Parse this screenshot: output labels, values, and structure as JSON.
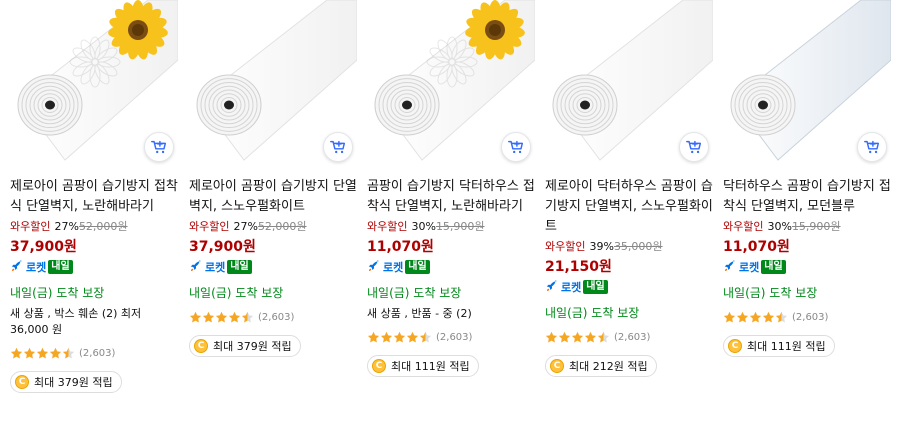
{
  "colors": {
    "price_red": "#ae0000",
    "delivery_green": "#00891a",
    "rocket_blue": "#0073e9",
    "star_orange": "#f5a623"
  },
  "products": [
    {
      "name": "제로아이 곰팡이 습기방지 접착식 단열벽지, 노란해바라기",
      "discount_label": "와우할인",
      "discount_rate": "27%",
      "original_price": "52,000원",
      "price": "37,900원",
      "rocket_label": "로켓",
      "rocket_badge": "내일",
      "delivery": "내일(금) 도착 보장",
      "extra": "새 상품 , 박스 훼손 (2) 최저 36,000 원",
      "rating": 4.5,
      "review_count": "(2,603)",
      "reward": "최대 379원 적립",
      "cart_icon": "add-to-cart-icon"
    },
    {
      "name": "제로아이 곰팡이 습기방지 단열벽지, 스노우펄화이트",
      "discount_label": "와우할인",
      "discount_rate": "27%",
      "original_price": "52,000원",
      "price": "37,900원",
      "rocket_label": "로켓",
      "rocket_badge": "내일",
      "delivery": "내일(금) 도착 보장",
      "rating": 4.5,
      "review_count": "(2,603)",
      "reward": "최대 379원 적립",
      "cart_icon": "add-to-cart-icon"
    },
    {
      "name": "곰팡이 습기방지 닥터하우스 접착식 단열벽지, 노란해바라기",
      "discount_label": "와우할인",
      "discount_rate": "30%",
      "original_price": "15,900원",
      "price": "11,070원",
      "rocket_label": "로켓",
      "rocket_badge": "내일",
      "delivery": "내일(금) 도착 보장",
      "extra": "새 상품 , 반품 - 중 (2)",
      "rating": 4.5,
      "review_count": "(2,603)",
      "reward": "최대 111원 적립",
      "cart_icon": "add-to-cart-icon"
    },
    {
      "name": "제로아이 닥터하우스 곰팡이 습기방지 단열벽지, 스노우펄화이트",
      "discount_label": "와우할인",
      "discount_rate": "39%",
      "original_price": "35,000원",
      "price": "21,150원",
      "rocket_label": "로켓",
      "rocket_badge": "내일",
      "delivery": "내일(금) 도착 보장",
      "rating": 4.5,
      "review_count": "(2,603)",
      "reward": "최대 212원 적립",
      "cart_icon": "add-to-cart-icon"
    },
    {
      "name": "닥터하우스 곰팡이 습기방지 접착식 단열벽지, 모던블루",
      "discount_label": "와우할인",
      "discount_rate": "30%",
      "original_price": "15,900원",
      "price": "11,070원",
      "rocket_label": "로켓",
      "rocket_badge": "내일",
      "delivery": "내일(금) 도착 보장",
      "rating": 4.5,
      "review_count": "(2,603)",
      "reward": "최대 111원 적립",
      "cart_icon": "add-to-cart-icon"
    }
  ]
}
